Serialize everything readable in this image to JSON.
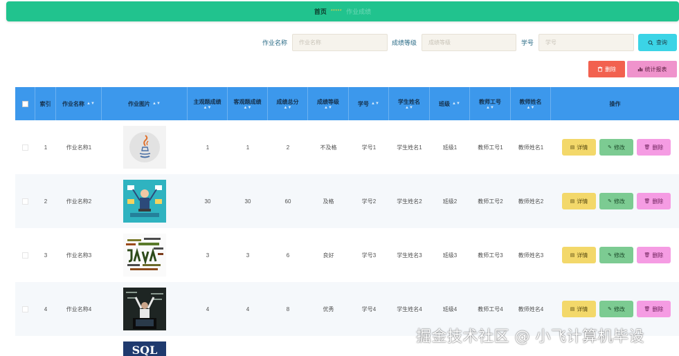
{
  "nav": {
    "home": "首页",
    "stars": "*****",
    "crumb": "作业成绩"
  },
  "search": {
    "fields": [
      {
        "label": "作业名称",
        "placeholder": "作业名称"
      },
      {
        "label": "成绩等级",
        "placeholder": "成绩等级"
      },
      {
        "label": "学号",
        "placeholder": "学号"
      }
    ],
    "query_label": "查询"
  },
  "toolbar": {
    "delete_label": "删除",
    "stats_label": "统计报表"
  },
  "table": {
    "headers": [
      "索引",
      "作业名称",
      "作业图片",
      "主观题成绩",
      "客观题成绩",
      "成绩总分",
      "成绩等级",
      "学号",
      "学生姓名",
      "班级",
      "教师工号",
      "教师姓名",
      "操作"
    ],
    "sort_glyph": "▲▼",
    "actions": {
      "detail": "详情",
      "edit": "修改",
      "delete": "删除"
    },
    "rows": [
      {
        "index": "1",
        "name": "作业名称1",
        "image": "java-logo-image",
        "subjective": "1",
        "objective": "1",
        "total": "2",
        "grade": "不及格",
        "student_id": "学号1",
        "student_name": "学生姓名1",
        "class": "班级1",
        "teacher_id": "教师工号1",
        "teacher_name": "教师姓名1"
      },
      {
        "index": "2",
        "name": "作业名称2",
        "image": "multitasking-developer-image",
        "subjective": "30",
        "objective": "30",
        "total": "60",
        "grade": "及格",
        "student_id": "学号2",
        "student_name": "学生姓名2",
        "class": "班级2",
        "teacher_id": "教师工号2",
        "teacher_name": "教师姓名2"
      },
      {
        "index": "3",
        "name": "作业名称3",
        "image": "java-wordcloud-image",
        "subjective": "3",
        "objective": "3",
        "total": "6",
        "grade": "良好",
        "student_id": "学号3",
        "student_name": "学生姓名3",
        "class": "班级3",
        "teacher_id": "教师工号3",
        "teacher_name": "教师姓名3"
      },
      {
        "index": "4",
        "name": "作业名称4",
        "image": "chalkboard-coder-image",
        "subjective": "4",
        "objective": "4",
        "total": "8",
        "grade": "优秀",
        "student_id": "学号4",
        "student_name": "学生姓名4",
        "class": "班级4",
        "teacher_id": "教师工号4",
        "teacher_name": "教师姓名4"
      }
    ],
    "partial_row_image_text": "SQL"
  },
  "watermark": "掘金技术社区 @ 小飞计算机毕设",
  "colors": {
    "topbar": "#21c38e",
    "header": "#3c98ec",
    "query": "#3bd4e6",
    "delete": "#f2614f",
    "stats": "#ef93cc",
    "detail": "#f3d86a",
    "edit": "#7ccb92",
    "row_delete": "#f59ce3"
  }
}
